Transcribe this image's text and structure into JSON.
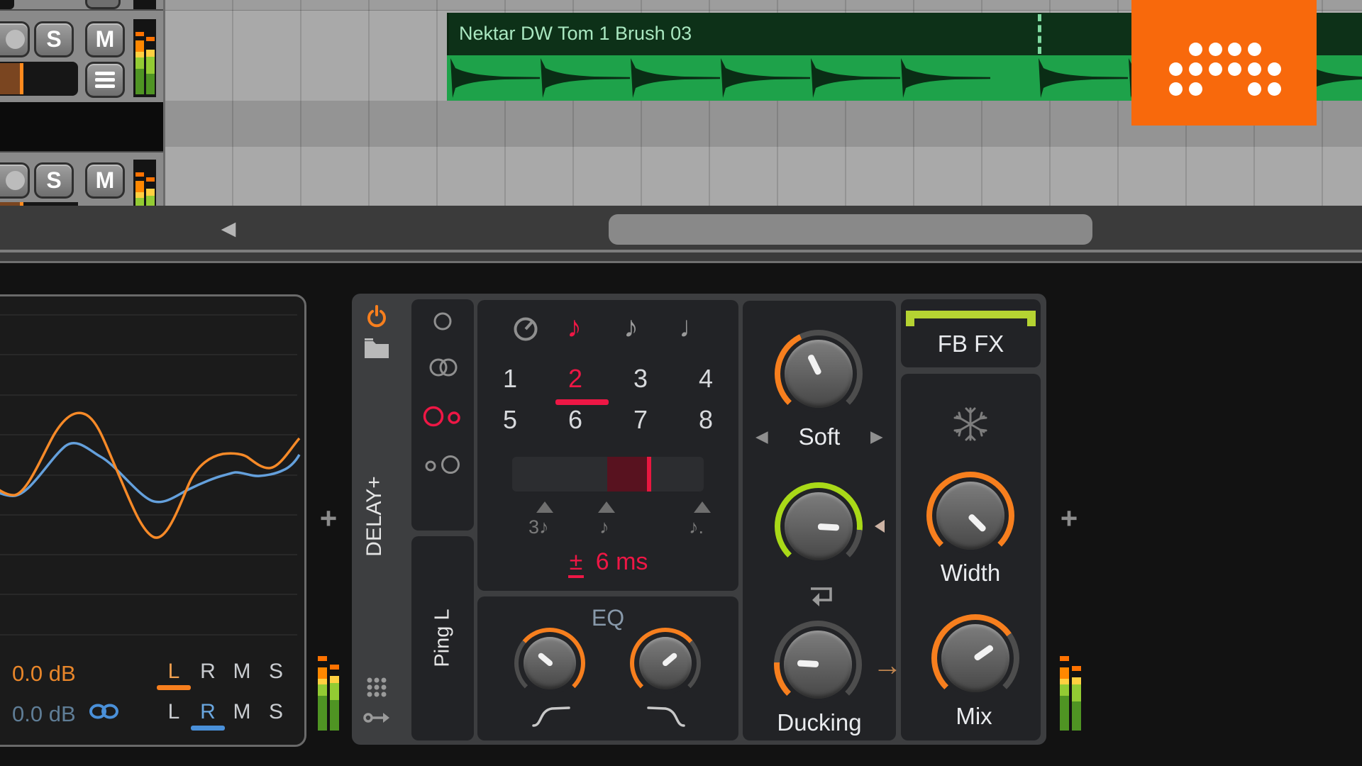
{
  "arranger": {
    "tracks": [
      {
        "solo": "S",
        "mute": "M"
      },
      {
        "solo": "S",
        "mute": "M"
      }
    ],
    "clip": {
      "name": "Nektar DW Tom 1 Brush 03"
    }
  },
  "scrollbar": {
    "left_arrow": "◀"
  },
  "chain": {
    "add_before": "+",
    "add_after": "+"
  },
  "device": {
    "title": "DELAY+",
    "mode": "Ping L",
    "sync_notes": {
      "sixteenth": "♪",
      "eighth": "♪",
      "quarter": "♩"
    },
    "beats": [
      "1",
      "2",
      "3",
      "4",
      "5",
      "6",
      "7",
      "8"
    ],
    "selected_beat": "2",
    "fine_markers": {
      "triplet": "3♪",
      "straight": "♪",
      "dotted": "♪."
    },
    "offset_sign": "±",
    "offset_value": "6 ms",
    "eq": {
      "label": "EQ"
    },
    "drive_mode": {
      "prev": "◀",
      "label": "Soft",
      "next": "▶"
    },
    "ducking": {
      "label": "Ducking"
    },
    "routing_arrow": "→",
    "fb_fx": {
      "label": "FB FX"
    },
    "width_knob": {
      "label": "Width"
    },
    "mix_knob": {
      "label": "Mix"
    }
  },
  "footer_panel": {
    "rows": [
      {
        "gain": "0.0 dB",
        "channels": [
          "L",
          "R",
          "M",
          "S"
        ],
        "active": "L"
      },
      {
        "gain": "0.0 dB",
        "channels": [
          "L",
          "R",
          "M",
          "S"
        ],
        "active": "R"
      }
    ]
  },
  "colors": {
    "accent_orange": "#f77f1e",
    "accent_red": "#ee1745",
    "accent_green": "#a9d918",
    "accent_blue": "#4a90d9",
    "fbfx_green": "#b5d332",
    "clip_green": "#1ea24a",
    "logo_orange": "#f8690c"
  }
}
